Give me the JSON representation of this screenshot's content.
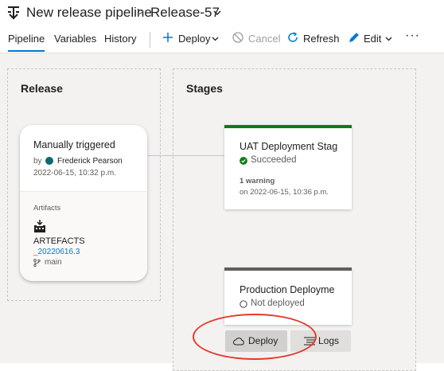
{
  "header": {
    "title": "New release pipeline",
    "separator": ">",
    "release": "Release-57"
  },
  "tabs": [
    {
      "label": "Pipeline",
      "active": true
    },
    {
      "label": "Variables",
      "active": false
    },
    {
      "label": "History",
      "active": false
    }
  ],
  "toolbar": {
    "deploy": "Deploy",
    "cancel": "Cancel",
    "refresh": "Refresh",
    "edit": "Edit",
    "more": "···"
  },
  "release_panel": {
    "title": "Release",
    "trigger_title": "Manually triggered",
    "by_label": "by",
    "author": "Frederick Pearson",
    "author_initials": "FP",
    "date": "2022-06-15, 10:32 p.m.",
    "artifacts_label": "Artifacts",
    "artifact_name": "ARTEFACTS",
    "artifact_version": "_20220616.3",
    "branch": "main"
  },
  "stages_panel": {
    "title": "Stages",
    "stages": [
      {
        "name": "UAT Deployment Stag",
        "status": "Succeeded",
        "warning": "1 warning",
        "date": "on 2022-06-15, 10:36 p.m.",
        "accent_color": "#107c10"
      },
      {
        "name": "Production Deployme",
        "status": "Not deployed",
        "accent_color": "#605e5c"
      }
    ],
    "deploy_button": "Deploy",
    "logs_button": "Logs"
  },
  "colors": {
    "accent": "#0078d4",
    "success": "#107c10",
    "annotation": "#e53a2a",
    "canvas": "#f3f2f1"
  },
  "icons": {
    "pipeline": "pipeline-icon",
    "deploy": "plus-icon",
    "cancel": "cancel-icon",
    "refresh": "refresh-icon",
    "edit": "pencil-icon",
    "artifact": "artifact-icon",
    "branch": "branch-icon",
    "succeeded": "check-circle-icon",
    "not_deployed": "empty-circle-icon",
    "deploy_cloud": "cloud-icon",
    "logs": "logs-icon"
  }
}
